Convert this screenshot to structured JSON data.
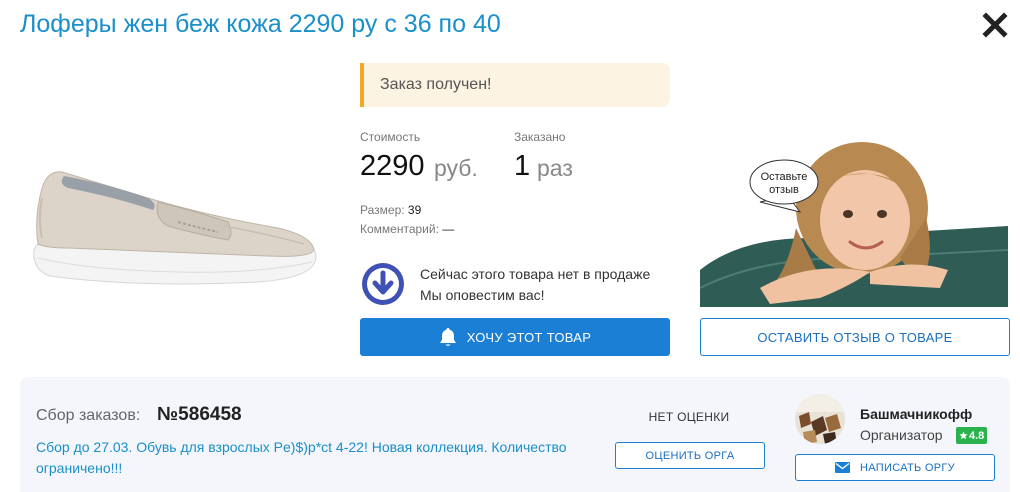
{
  "page": {
    "title": "Лоферы жен беж кожа 2290 ру с 36 по 40"
  },
  "order_status": "Заказ получен!",
  "cost": {
    "label": "Стоимость",
    "value": "2290",
    "unit": "руб."
  },
  "ordered": {
    "label": "Заказано",
    "value": "1",
    "unit": "раз"
  },
  "details": {
    "size_label": "Размер:",
    "size_value": "39",
    "comment_label": "Комментарий:",
    "comment_value": "—"
  },
  "notify": {
    "line1": "Сейчас этого товара нет в продаже",
    "line2": "Мы оповестим вас!"
  },
  "buttons": {
    "want": "ХОЧУ ЭТОТ ТОВАР",
    "review": "ОСТАВИТЬ ОТЗЫВ О ТОВАРЕ",
    "rate": "ОЦЕНИТЬ ОРГА",
    "write": "НАПИСАТЬ ОРГУ"
  },
  "review_bubble": {
    "line1": "Оставьте",
    "line2": "отзыв"
  },
  "collection": {
    "label": "Сбор заказов:",
    "number": "№586458",
    "description": "Сбор до 27.03. Обувь для взрослых Pe)$)p*ct 4-22! Новая коллекция. Количество ограничено!!!"
  },
  "organizer": {
    "rating_status": "НЕТ ОЦЕНКИ",
    "name": "Башмачникофф",
    "role": "Организатор",
    "rating": "4.8"
  },
  "colors": {
    "accent": "#1c7fd6",
    "title": "#1a8fc9",
    "status_bg": "#fdf3e2",
    "status_border": "#f5a623",
    "badge": "#2bb24c",
    "panel_bg": "#f4f6fb",
    "notify_icon": "#3f51b5"
  },
  "icons": {
    "close": "close-icon",
    "notify": "arrow-down-circle-icon",
    "bell": "bell-icon",
    "mail": "envelope-icon",
    "star": "star-icon"
  }
}
